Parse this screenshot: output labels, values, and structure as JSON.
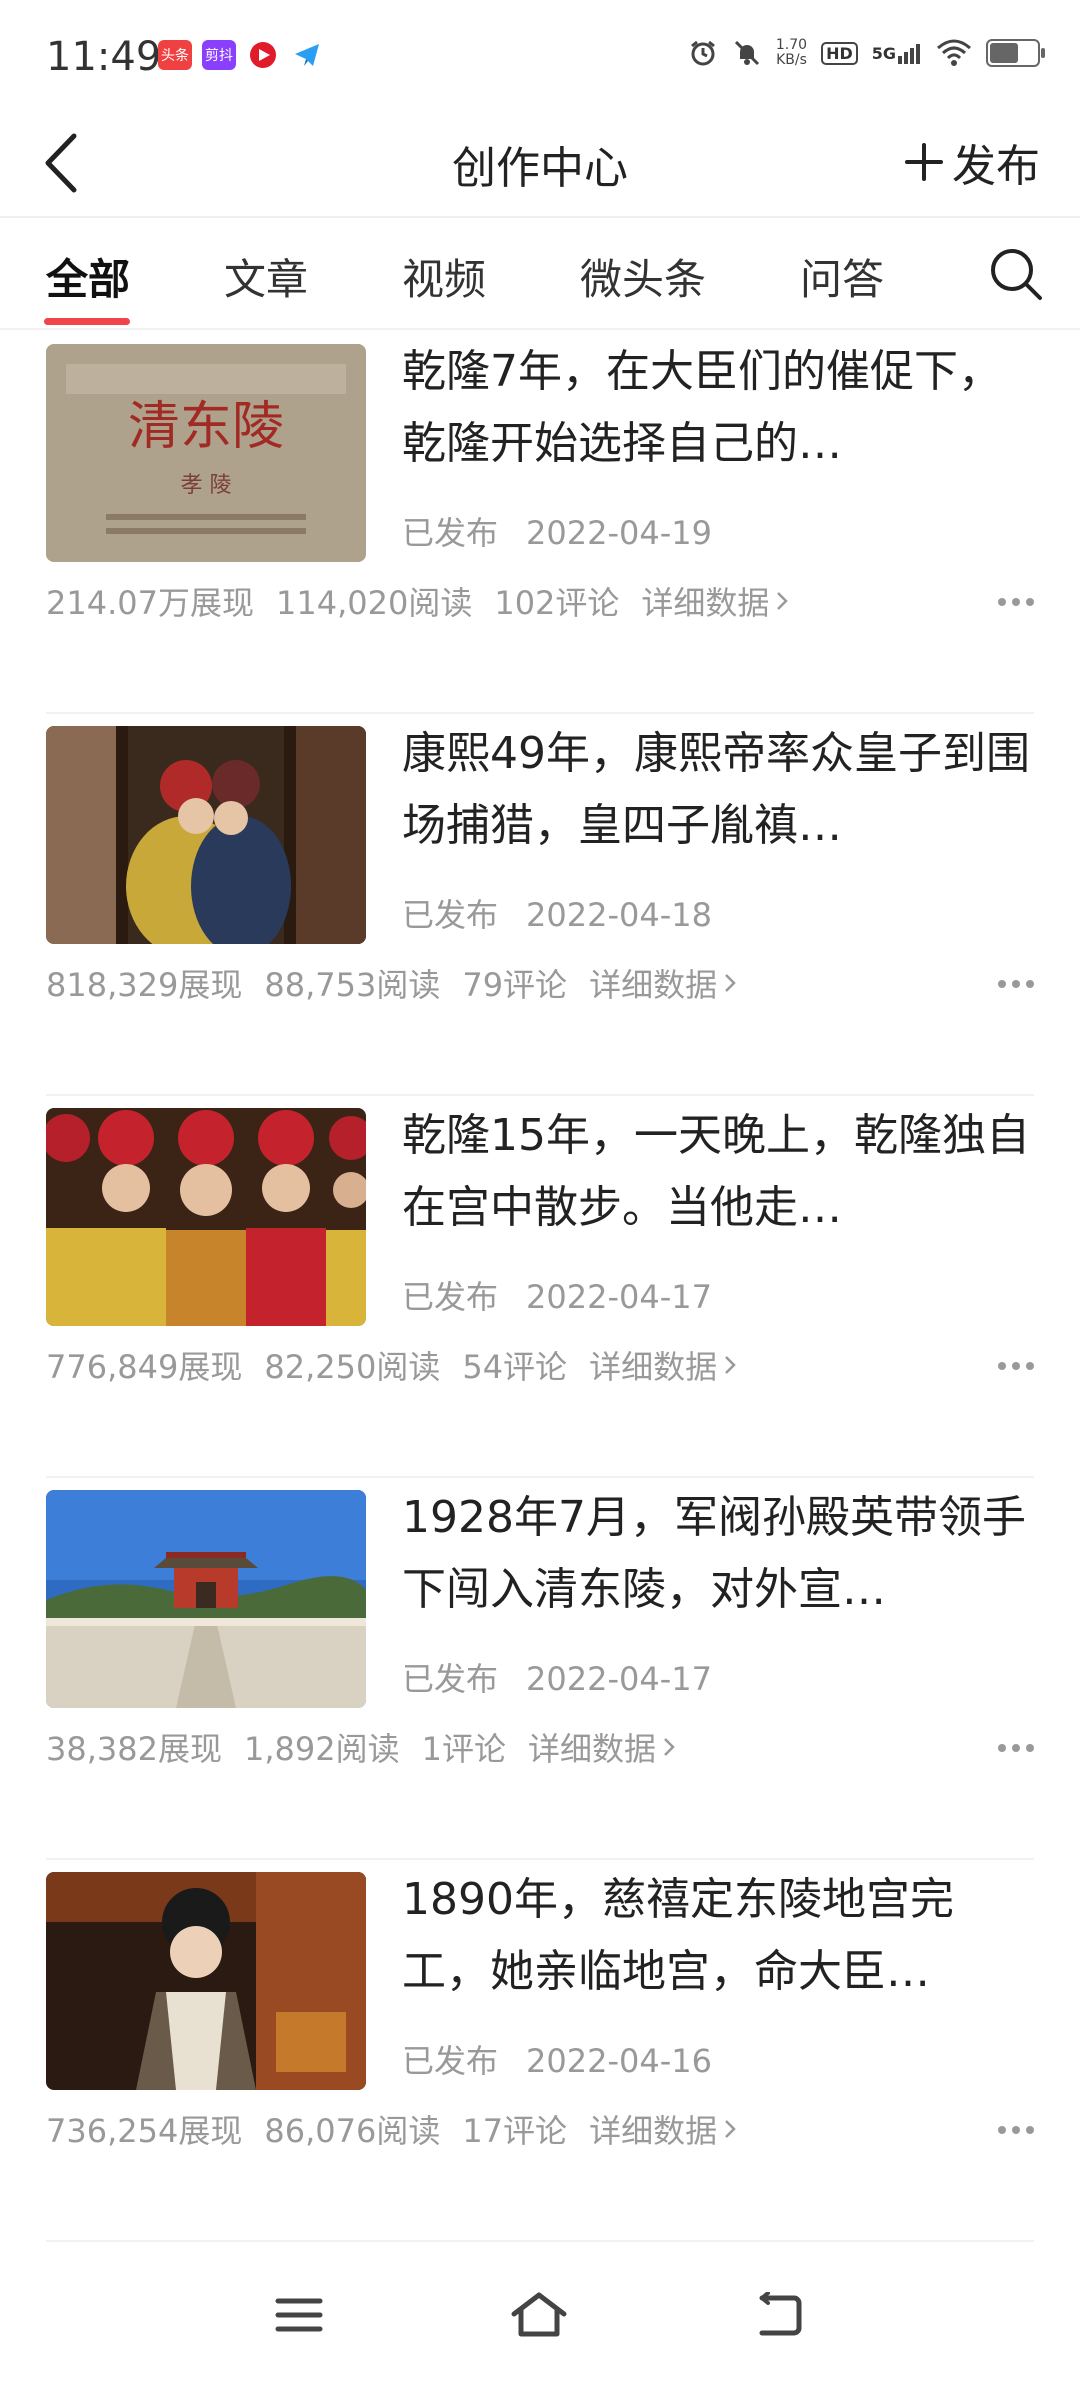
{
  "status_bar": {
    "time": "11:49",
    "apps": [
      {
        "name": "头条",
        "color": "#f04142"
      },
      {
        "name": "剪抖",
        "color": "#8a3ffc"
      },
      {
        "name": "",
        "color": "#e21b2a"
      },
      {
        "name": "",
        "color": "#2a9df4"
      }
    ],
    "net_speed": "1.70",
    "net_unit": "KB/s",
    "hd": "HD",
    "network": "5G",
    "battery_level": 0.55
  },
  "header": {
    "title": "创作中心",
    "publish_label": "发布"
  },
  "tabs": [
    "全部",
    "文章",
    "视频",
    "微头条",
    "问答"
  ],
  "active_tab": 0,
  "accent_color": "#f0434a",
  "articles": [
    {
      "title": "乾隆7年，在大臣们的催促下，乾隆开始选择自己的…",
      "status": "已发布",
      "date": "2022-04-19",
      "impressions": "214.07万展现",
      "reads": "114,020阅读",
      "comments": "102评论",
      "detail_label": "详细数据",
      "thumb": "stele"
    },
    {
      "title": "康熙49年，康熙帝率众皇子到围场捕猎，皇四子胤禛…",
      "status": "已发布",
      "date": "2022-04-18",
      "impressions": "818,329展现",
      "reads": "88,753阅读",
      "comments": "79评论",
      "detail_label": "详细数据",
      "thumb": "couple"
    },
    {
      "title": "乾隆15年，一天晚上，乾隆独自在宫中散步。当他走…",
      "status": "已发布",
      "date": "2022-04-17",
      "impressions": "776,849展现",
      "reads": "82,250阅读",
      "comments": "54评论",
      "detail_label": "详细数据",
      "thumb": "princes"
    },
    {
      "title": "1928年7月，军阀孙殿英带领手下闯入清东陵，对外宣…",
      "status": "已发布",
      "date": "2022-04-17",
      "impressions": "38,382展现",
      "reads": "1,892阅读",
      "comments": "1评论",
      "detail_label": "详细数据",
      "thumb": "tomb"
    },
    {
      "title": "1890年，慈禧定东陵地宫完工，她亲临地宫，命大臣…",
      "status": "已发布",
      "date": "2022-04-16",
      "impressions": "736,254展现",
      "reads": "86,076阅读",
      "comments": "17评论",
      "detail_label": "详细数据",
      "thumb": "empress"
    }
  ],
  "icons": {
    "back": "chevron-left-icon",
    "publish": "plus-icon",
    "search": "search-icon",
    "more": "more-dots-icon",
    "nav_menu": "menu-icon",
    "nav_home": "home-icon",
    "nav_back": "back-icon"
  }
}
